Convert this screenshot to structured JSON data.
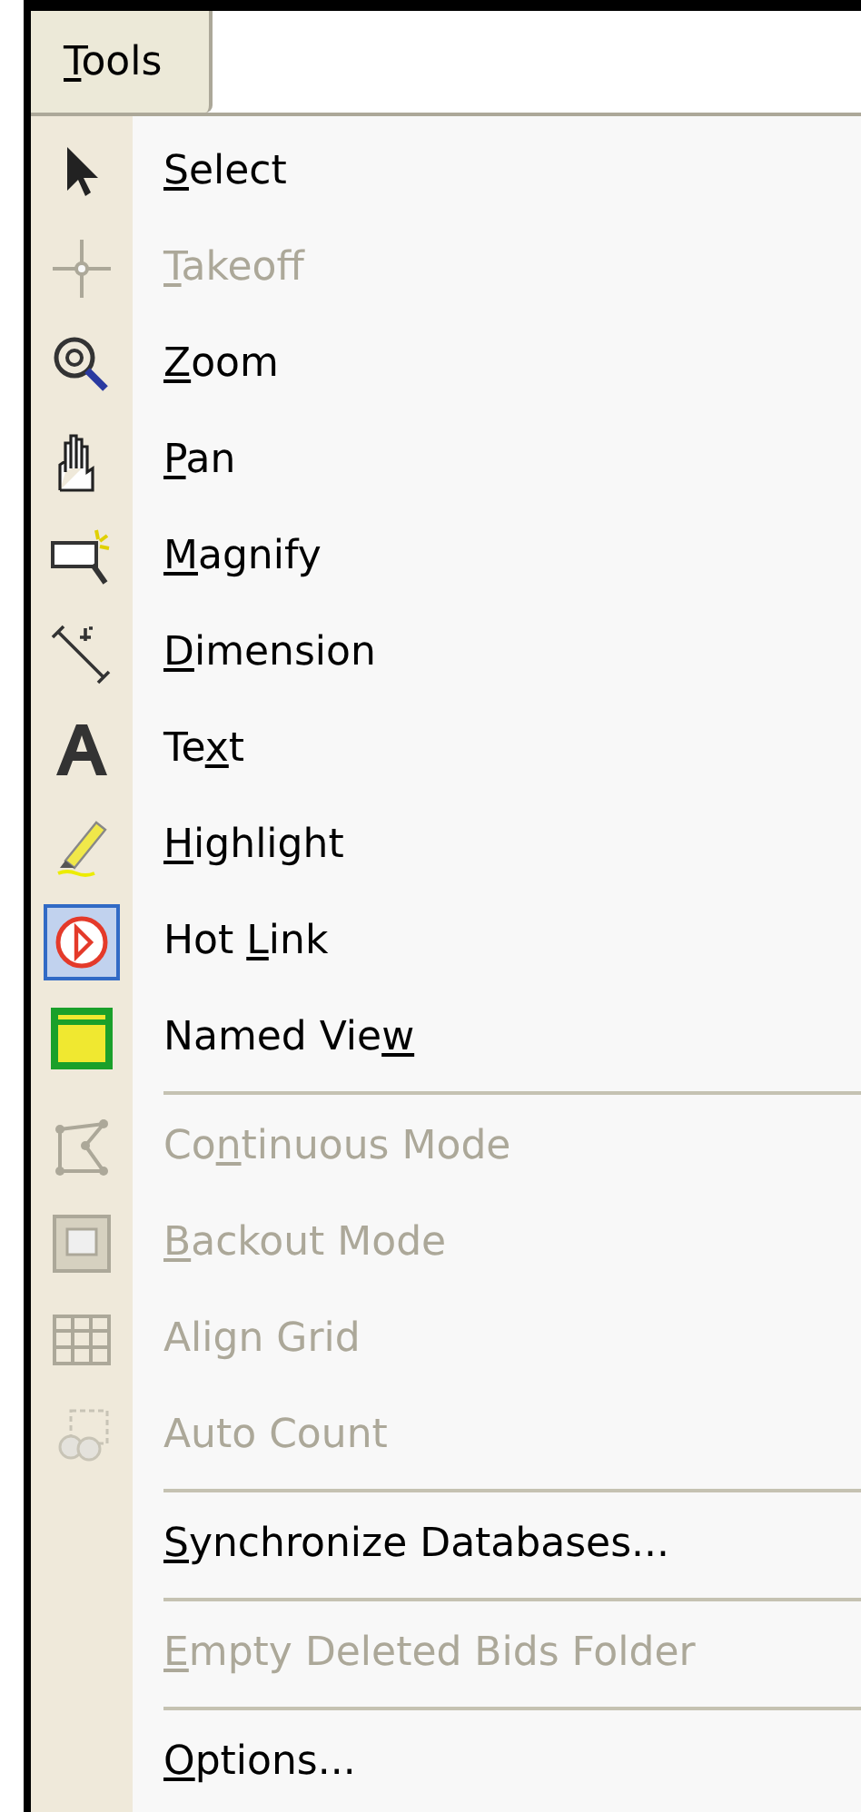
{
  "menu_bar": [
    {
      "key": "T",
      "post": "ools",
      "selected": true
    }
  ],
  "menu": [
    {
      "kind": "item",
      "key": "S",
      "post": "elect",
      "disabled": false,
      "checked": false
    },
    {
      "kind": "item",
      "key": "T",
      "post": "akeoff",
      "disabled": true,
      "checked": false
    },
    {
      "kind": "item",
      "key": "Z",
      "post": "oom",
      "disabled": false,
      "checked": false
    },
    {
      "kind": "item",
      "key": "P",
      "post": "an",
      "disabled": false,
      "checked": false
    },
    {
      "kind": "item",
      "key": "M",
      "post": "agnify",
      "disabled": false,
      "checked": false
    },
    {
      "kind": "item",
      "key": "D",
      "post": "imension",
      "disabled": false,
      "checked": false
    },
    {
      "kind": "item",
      "pre": "Te",
      "key": "x",
      "post": "t",
      "disabled": false,
      "checked": false
    },
    {
      "kind": "item",
      "key": "H",
      "post": "ighlight",
      "disabled": false,
      "checked": false
    },
    {
      "kind": "item",
      "pre": "Hot ",
      "key": "L",
      "post": "ink",
      "disabled": false,
      "checked": true
    },
    {
      "kind": "item",
      "pre": "Named Vie",
      "key": "w",
      "disabled": false,
      "checked": false
    },
    {
      "kind": "separator"
    },
    {
      "kind": "item",
      "pre": "Co",
      "key": "n",
      "post": "tinuous Mode",
      "disabled": true,
      "checked": false
    },
    {
      "kind": "item",
      "key": "B",
      "post": "ackout Mode",
      "disabled": true,
      "checked": false
    },
    {
      "kind": "item",
      "pre": "Align Grid",
      "disabled": true,
      "checked": false
    },
    {
      "kind": "item",
      "pre": "Auto Count",
      "disabled": true,
      "checked": false
    },
    {
      "kind": "separator"
    },
    {
      "kind": "item",
      "key": "S",
      "post": "ynchronize Databases...",
      "disabled": false,
      "checked": false
    },
    {
      "kind": "separator"
    },
    {
      "kind": "item",
      "key": "E",
      "post": "mpty Deleted Bids Folder",
      "disabled": true,
      "checked": false
    },
    {
      "kind": "separator"
    },
    {
      "kind": "item",
      "key": "O",
      "post": "ptions...",
      "disabled": false,
      "checked": false
    }
  ]
}
